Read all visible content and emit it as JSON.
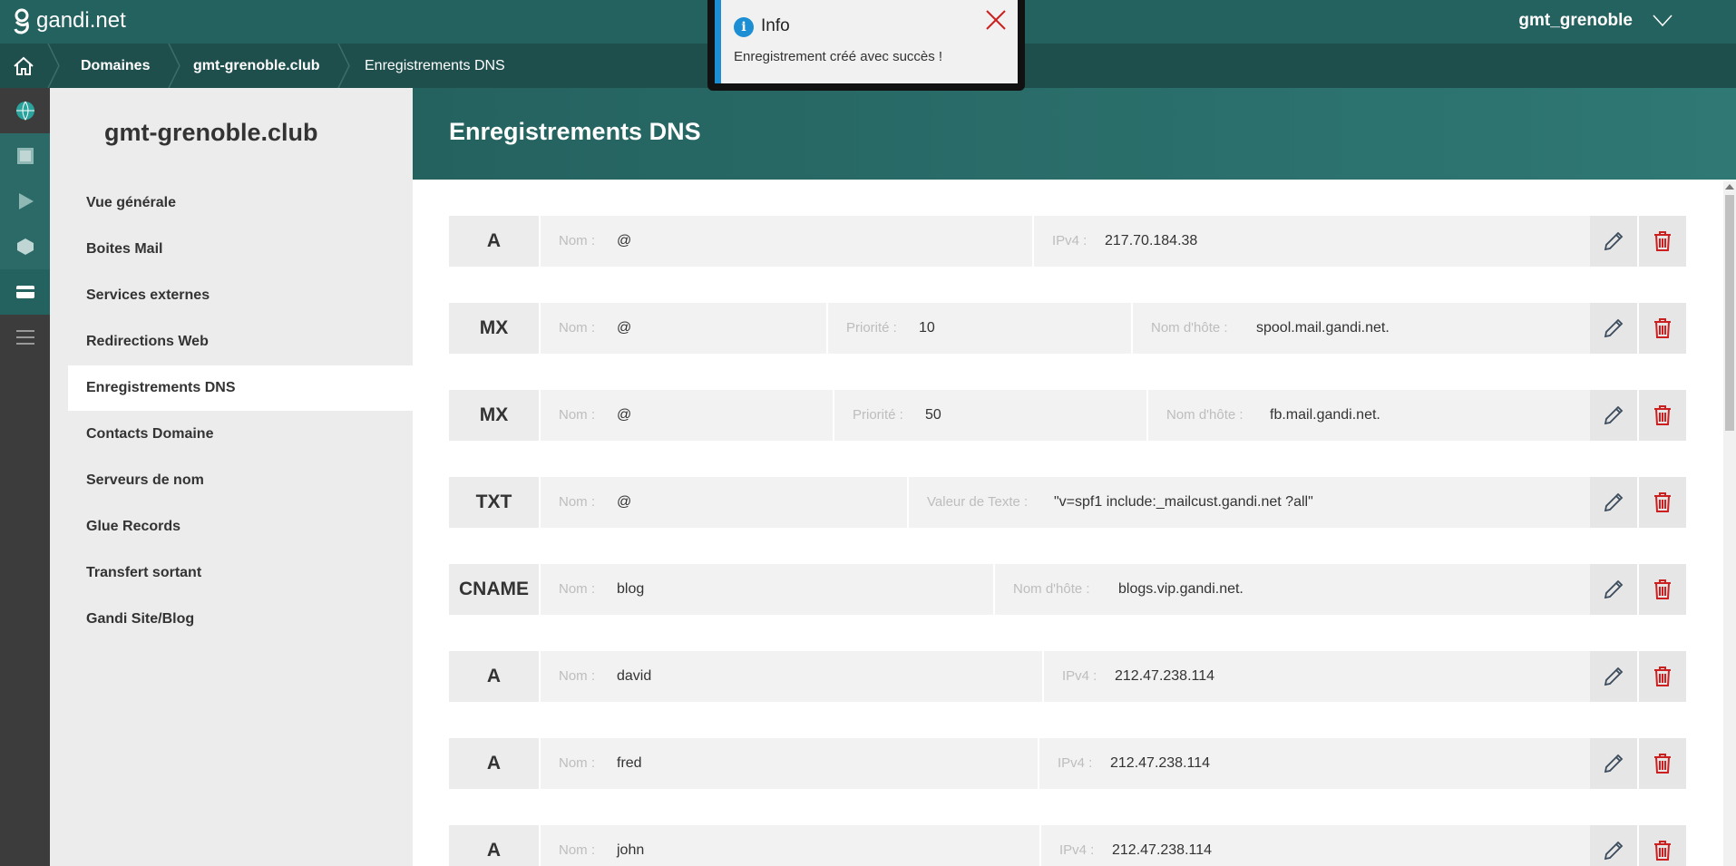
{
  "brand": {
    "name": "gandi.net"
  },
  "user": {
    "name": "gmt_grenoble"
  },
  "breadcrumb": [
    "Domaines",
    "gmt-grenoble.club",
    "Enregistrements DNS"
  ],
  "sidebar": {
    "title": "gmt-grenoble.club",
    "items": [
      {
        "label": "Vue générale"
      },
      {
        "label": "Boites Mail"
      },
      {
        "label": "Services externes"
      },
      {
        "label": "Redirections Web"
      },
      {
        "label": "Enregistrements DNS",
        "active": true
      },
      {
        "label": "Contacts Domaine"
      },
      {
        "label": "Serveurs de nom"
      },
      {
        "label": "Glue Records"
      },
      {
        "label": "Transfert sortant"
      },
      {
        "label": "Gandi Site/Blog"
      }
    ]
  },
  "main": {
    "title": "Enregistrements DNS"
  },
  "records": [
    {
      "type": "A",
      "fields": [
        {
          "label": "Nom :",
          "value": "@"
        },
        {
          "label": "IPv4 :",
          "value": "217.70.184.38"
        }
      ]
    },
    {
      "type": "MX",
      "fields": [
        {
          "label": "Nom :",
          "value": "@"
        },
        {
          "label": "Priorité :",
          "value": "10"
        },
        {
          "label": "Nom d'hôte :",
          "value": "spool.mail.gandi.net."
        }
      ]
    },
    {
      "type": "MX",
      "fields": [
        {
          "label": "Nom :",
          "value": "@"
        },
        {
          "label": "Priorité :",
          "value": "50"
        },
        {
          "label": "Nom d'hôte :",
          "value": "fb.mail.gandi.net."
        }
      ]
    },
    {
      "type": "TXT",
      "fields": [
        {
          "label": "Nom :",
          "value": "@"
        },
        {
          "label": "Valeur de Texte :",
          "value": "\"v=spf1 include:_mailcust.gandi.net ?all\""
        }
      ]
    },
    {
      "type": "CNAME",
      "fields": [
        {
          "label": "Nom :",
          "value": "blog"
        },
        {
          "label": "Nom d'hôte :",
          "value": "blogs.vip.gandi.net."
        }
      ]
    },
    {
      "type": "A",
      "fields": [
        {
          "label": "Nom :",
          "value": "david"
        },
        {
          "label": "IPv4 :",
          "value": "212.47.238.114"
        }
      ]
    },
    {
      "type": "A",
      "fields": [
        {
          "label": "Nom :",
          "value": "fred"
        },
        {
          "label": "IPv4 :",
          "value": "212.47.238.114"
        }
      ]
    },
    {
      "type": "A",
      "fields": [
        {
          "label": "Nom :",
          "value": "john"
        },
        {
          "label": "IPv4 :",
          "value": "212.47.238.114"
        }
      ]
    }
  ],
  "toast": {
    "title": "Info",
    "message": "Enregistrement créé avec succès !",
    "icon": "info-icon"
  },
  "icons": {
    "edit": "pencil-icon",
    "delete": "trash-icon"
  },
  "colors": {
    "primary": "#24625f",
    "delete": "#cc1f1f",
    "info": "#1c8fd4"
  }
}
